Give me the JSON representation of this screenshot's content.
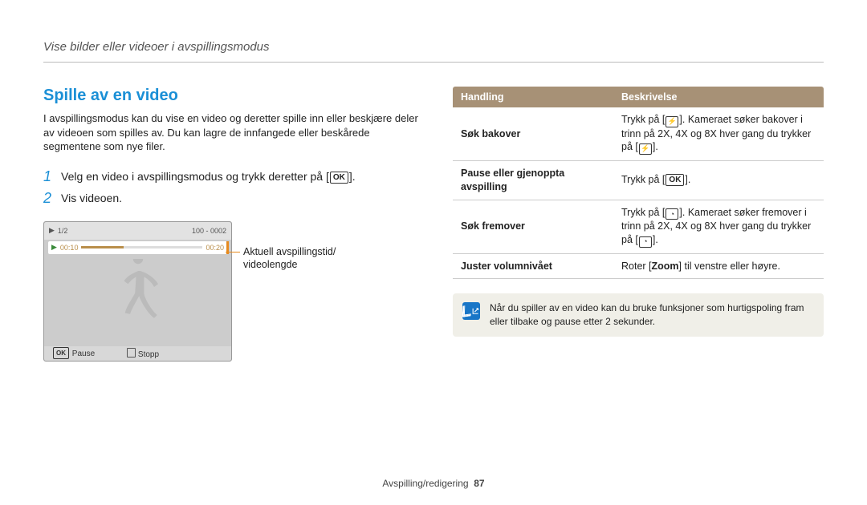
{
  "header": "Vise bilder eller videoer i avspillingsmodus",
  "section_title": "Spille av en video",
  "intro": "I avspillingsmodus kan du vise en video og deretter spille inn eller beskjære deler av videoen som spilles av. Du kan lagre de innfangede eller beskårede segmentene som nye filer.",
  "step1_num": "1",
  "step1_text_a": "Velg en video i avspillingsmodus og trykk deretter på [",
  "step1_ok": "OK",
  "step1_text_b": "].",
  "step2_num": "2",
  "step2_text": "Vis videoen.",
  "thumb": {
    "count": "1/2",
    "right_info": "100 - 0002",
    "time_left": "00:10",
    "time_right": "00:20",
    "pause_btn_ok": "OK",
    "pause_label": "Pause",
    "stop_label": "Stopp"
  },
  "caption_l1": "Aktuell avspillingstid/",
  "caption_l2": "videolengde",
  "table": {
    "h1": "Handling",
    "h2": "Beskrivelse",
    "rows": [
      {
        "action": "Søk bakover",
        "d1": "Trykk på [",
        "ic1": "flash",
        "d2": "]. Kameraet søker bakover i trinn på 2X, 4X og 8X hver gang du trykker på [",
        "ic2": "flash",
        "d3": "]."
      },
      {
        "action": "Pause eller gjenoppta avspilling",
        "d1": "Trykk på [",
        "ic1": "ok",
        "d2": "].",
        "ic2": "",
        "d3": ""
      },
      {
        "action": "Søk fremover",
        "d1": "Trykk på [",
        "ic1": "timer",
        "d2": "]. Kameraet søker fremover i trinn på 2X, 4X og 8X hver gang du trykker på [",
        "ic2": "timer",
        "d3": "]."
      },
      {
        "action": "Juster volumnivået",
        "d1": "Roter [",
        "bold": "Zoom",
        "d2": "] til venstre eller høyre.",
        "ic1": "",
        "ic2": "",
        "d3": ""
      }
    ]
  },
  "note": "Når du spiller av en video kan du bruke funksjoner som hurtigspoling fram eller tilbake og pause etter 2 sekunder.",
  "footer_label": "Avspilling/redigering",
  "footer_page": "87"
}
